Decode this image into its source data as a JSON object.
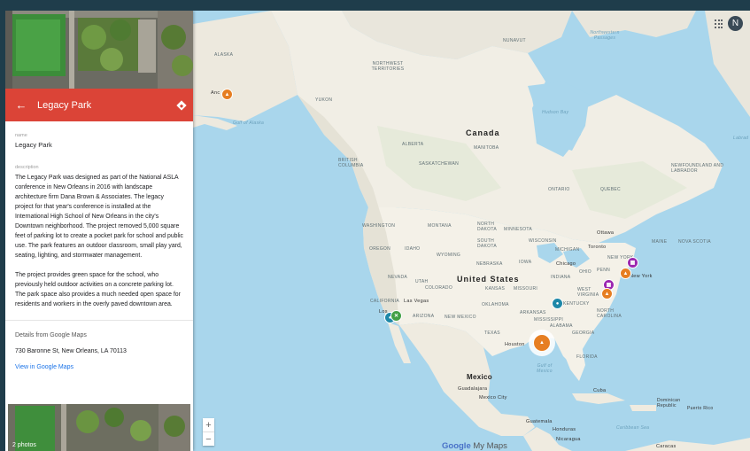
{
  "panel": {
    "title": "Legacy Park",
    "name_label": "name",
    "name_value": "Legacy Park",
    "description_label": "description",
    "description_p1": "The Legacy Park was designed as part of the National ASLA conference in New Orleans in 2016 with landscape architecture firm Dana Brown & Associates. The legacy project for that year's conference is installed at the International High School of New Orleans in the city's Downtown neighborhood. The project removed 5,000 square feet of parking lot to create a pocket park for school and public use. The park features an outdoor classroom, small play yard, seating, lighting, and stormwater management.",
    "description_p2": "The project provides green space for the school, who previously held outdoor activities on a concrete parking lot. The park space also provides a much needed open space for residents and workers in the overly paved downtown area.",
    "google_heading": "Details from Google Maps",
    "address": "730 Baronne St, New Orleans, LA 70113",
    "view_link": "View in Google Maps",
    "photos_caption": "2 photos",
    "back_icon": "arrow-left-icon",
    "directions_icon": "directions-icon"
  },
  "map": {
    "avatar_letter": "N",
    "apps_icon": "apps-grid-icon",
    "zoom_in": "+",
    "zoom_out": "−",
    "brand_google": "Google",
    "brand_mymaps": " My Maps",
    "labels": {
      "canada": "Canada",
      "united_states": "United States",
      "mexico": "Mexico",
      "alaska": "ALASKA",
      "nwt": "NORTHWEST TERRITORIES",
      "nunavut": "NUNAVUT",
      "northwest_passages": "Northwestern Passages",
      "gulf_alaska": "Gulf of Alaska",
      "hudson_bay": "Hudson Bay",
      "labrador": "Labrad",
      "yukon": "YUKON",
      "bc": "BRITISH COLUMBIA",
      "alberta": "ALBERTA",
      "saskatchewan": "SASKATCHEWAN",
      "manitoba": "MANITOBA",
      "ontario": "ONTARIO",
      "quebec": "QUEBEC",
      "newfoundland": "NEWFOUNDLAND AND LABRADOR",
      "washington": "WASHINGTON",
      "montana": "MONTANA",
      "north_dakota": "NORTH DAKOTA",
      "south_dakota": "SOUTH DAKOTA",
      "minnesota": "MINNESOTA",
      "wisconsin": "WISCONSIN",
      "michigan": "MICHIGAN",
      "oregon": "OREGON",
      "idaho": "IDAHO",
      "wyoming": "WYOMING",
      "nebraska": "NEBRASKA",
      "iowa": "IOWA",
      "nevada": "NEVADA",
      "utah": "UTAH",
      "colorado": "COLORADO",
      "kansas": "KANSAS",
      "missouri": "MISSOURI",
      "california": "CALIFORNIA",
      "arizona": "ARIZONA",
      "new_mexico": "NEW MEXICO",
      "oklahoma": "OKLAHOMA",
      "arkansas": "ARKANSAS",
      "texas": "TEXAS",
      "mississippi": "MISSISSIPPI",
      "alabama": "ALABAMA",
      "georgia": "GEORGIA",
      "florida": "FLORIDA",
      "tennessee": "TENNESSEE",
      "kentucky": "KENTUCKY",
      "indiana": "INDIANA",
      "ohio": "OHIO",
      "penn": "PENN",
      "new_york_state": "NEW YORK",
      "west_virginia": "WEST VIRGINIA",
      "virginia": "VIRGINIA",
      "north_carolina": "NORTH CAROLINA",
      "south_carolina": "SOUTH CAROLINA",
      "maine": "MAINE",
      "nova_scotia": "NOVA SCOTIA",
      "ottawa": "Ottawa",
      "toronto": "Toronto",
      "chicago": "Chicago",
      "new_york": "New York",
      "las_vegas": "Las Vegas",
      "los_angeles": "Los",
      "houston": "Houston",
      "gulf_mexico": "Gulf of Mexico",
      "guadalajara": "Guadalajara",
      "mexico_city": "Mexico City",
      "cuba": "Cuba",
      "dominican": "Dominican Republic",
      "puerto_rico": "Puerto Rico",
      "guatemala": "Guatemala",
      "honduras": "Honduras",
      "nicaragua": "Nicaragua",
      "caribbean": "Caribbean Sea",
      "caracas": "Caracas",
      "anchorage": "Anc"
    },
    "pins": [
      {
        "name": "anchorage-pin",
        "color": "orange",
        "icon": "park-icon"
      },
      {
        "name": "new-york-pin",
        "color": "orange",
        "icon": "park-icon"
      },
      {
        "name": "northeast-purple-pin",
        "color": "purple",
        "icon": "museum-icon"
      },
      {
        "name": "dc-purple-pin",
        "color": "purple",
        "icon": "museum-icon"
      },
      {
        "name": "virginia-orange-pin",
        "color": "orange",
        "icon": "park-icon"
      },
      {
        "name": "southeast-teal-pin",
        "color": "teal",
        "icon": "teal-icon"
      },
      {
        "name": "la-green-pin",
        "color": "green",
        "icon": "close-icon"
      },
      {
        "name": "la-teal-pin",
        "color": "teal",
        "icon": "teal-icon"
      },
      {
        "name": "new-orleans-selected-pin",
        "color": "orange",
        "icon": "park-icon"
      }
    ]
  },
  "colors": {
    "accent": "#db4437",
    "water": "#a9d6ec",
    "land": "#f2efe6",
    "link": "#1a73e8",
    "frame": "#1f3d4b"
  }
}
